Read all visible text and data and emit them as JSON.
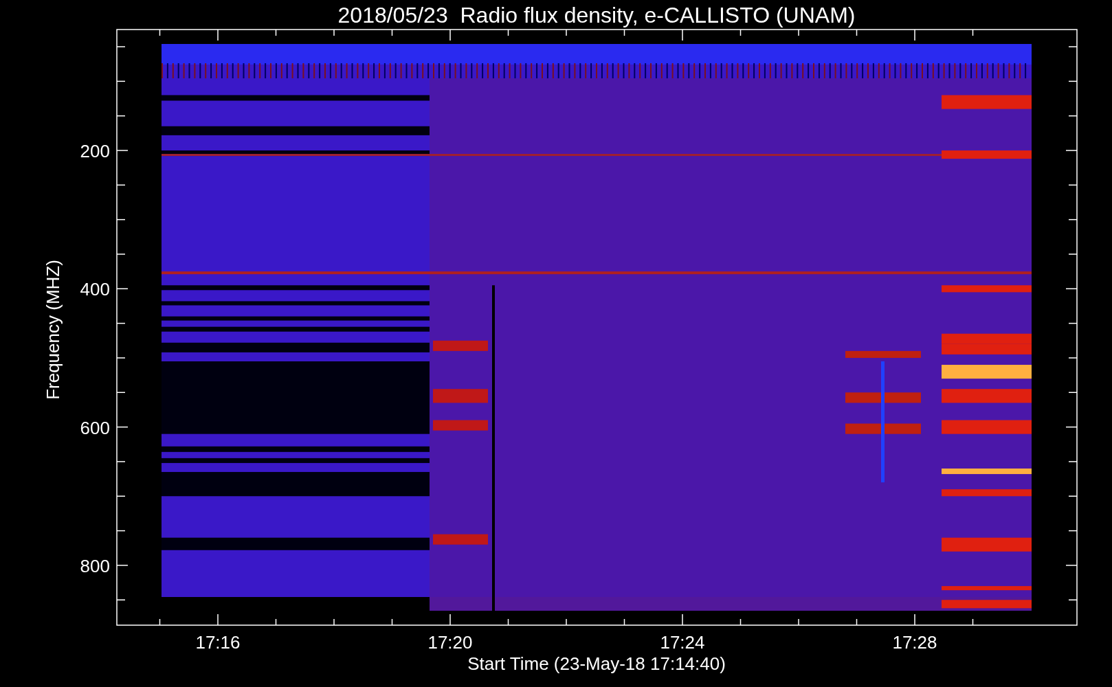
{
  "title": "2018/05/23  Radio flux density, e-CALLISTO (UNAM)",
  "y_axis": {
    "label": "Frequency (MHZ)",
    "ticks": [
      "200",
      "400",
      "600",
      "800"
    ]
  },
  "x_axis": {
    "label": "Start Time (23-May-18 17:14:40)",
    "ticks": [
      "17:16",
      "17:20",
      "17:24",
      "17:28"
    ]
  }
}
